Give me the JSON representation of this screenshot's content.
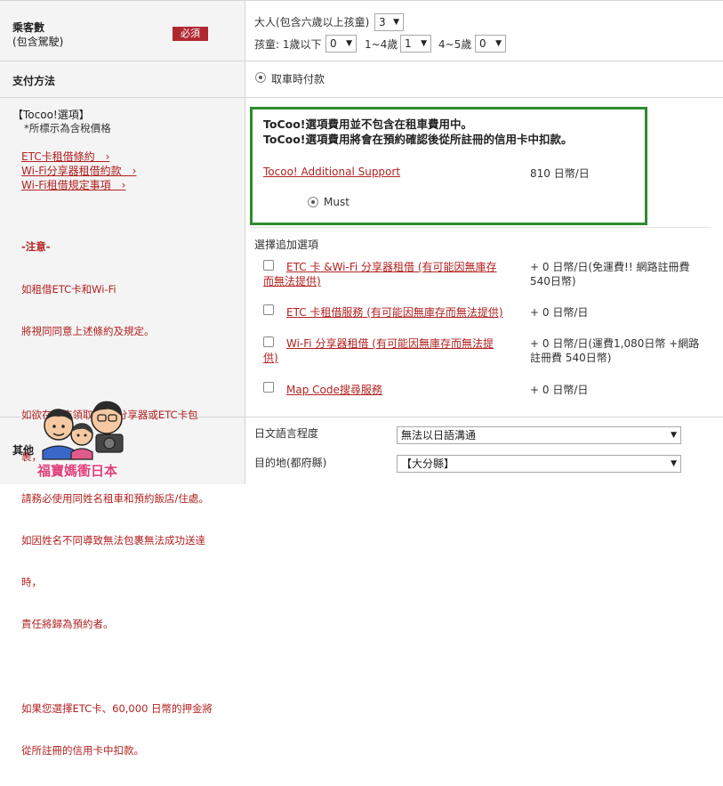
{
  "passengers": {
    "label_line1": "乘客數",
    "label_line2": "(包含駕駛)",
    "required_badge": "必須",
    "adults_label": "大人(包含六歲以上孩童)",
    "adults_value": "3",
    "children_label": "孩童: 1歲以下",
    "child_under1_value": "0",
    "child_1to4_label": "1~4歲",
    "child_1to4_value": "1",
    "child_4to5_label": "4~5歲",
    "child_4to5_value": "0"
  },
  "payment": {
    "label": "支付方法",
    "option": "取車時付款"
  },
  "tocoo": {
    "title": "【Tocoo!選項】",
    "subtitle": "*所標示為含稅價格",
    "links": [
      "ETC卡租借條約　›",
      "Wi-Fi分享器租借約款　›",
      "Wi-Fi租借規定事項　›"
    ],
    "notice_lines": [
      "-注意-",
      "如租借ETC卡和Wi-Fi",
      "將視同同意上述條約及規定。",
      "",
      "如欲在飯店領取Wi-Fi分享器或ETC卡包",
      "裹，",
      "請務必使用同姓名租車和預約飯店/住處。",
      "如因姓名不同導致無法包裹無法成功送達",
      "時，",
      "責任將歸為預約者。",
      "",
      "如果您選擇ETC卡、60,000 日幣的押金將",
      "從所註冊的信用卡中扣款。"
    ]
  },
  "notice_box": {
    "line1": "ToCoo!選項費用並不包含在租車費用中。",
    "line2": "ToCoo!選項費用將會在預約確認後從所註冊的信用卡中扣款。",
    "support_link": "Tocoo! Additional Support",
    "support_price": "810 日幣/日",
    "must_label": "Must"
  },
  "addons": {
    "heading": "選擇追加選項",
    "items": [
      {
        "line1": "ETC 卡 &Wi-Fi 分享器租借 (有可能因無庫存",
        "line2": "而無法提供)",
        "price1": "+ 0 日幣/日(免運費!! 網路註冊費",
        "price2": "540日幣)"
      },
      {
        "line1": "ETC 卡租借服務 (有可能因無庫存而無法提供)",
        "line2": "",
        "price1": "+ 0 日幣/日",
        "price2": ""
      },
      {
        "line1": "Wi-Fi 分享器租借 (有可能因無庫存而無法提",
        "line2": "供)",
        "price1": "+ 0 日幣/日(運費1,080日幣 +網路",
        "price2": "註冊費 540日幣)"
      },
      {
        "line1": "Map Code搜尋服務",
        "line2": "",
        "price1": "+ 0 日幣/日",
        "price2": ""
      }
    ]
  },
  "other": {
    "label": "其他",
    "japanese_label": "日文語言程度",
    "japanese_value": "無法以日語溝通",
    "destination_label": "目的地(都府縣)",
    "destination_value": "【大分縣】"
  },
  "watermark": {
    "text": "福寶媽衝日本"
  },
  "colors": {
    "accent_red": "#b22222",
    "badge_red": "#b0282f",
    "green_border": "#2e8b2e",
    "label_bg": "#f4f4f4"
  }
}
